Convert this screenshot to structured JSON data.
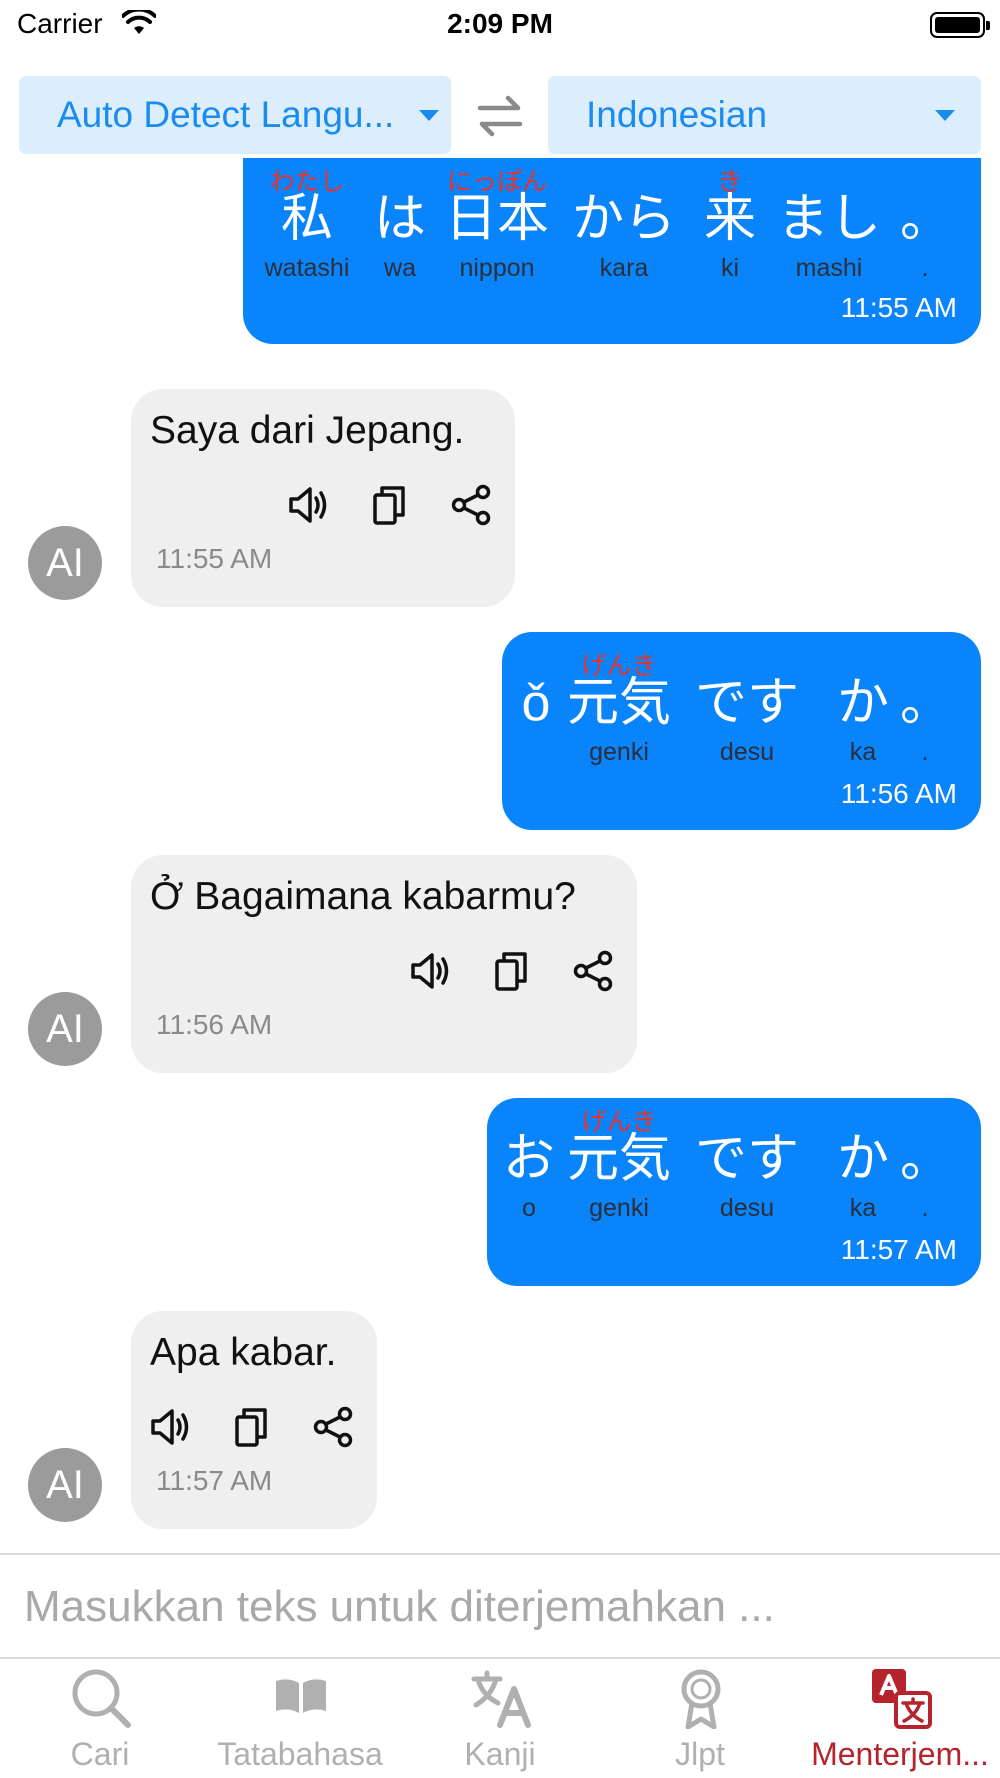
{
  "status_bar": {
    "carrier": "Carrier",
    "time": "2:09 PM"
  },
  "language_bar": {
    "source_language": "Auto Detect Langu...",
    "target_language": "Indonesian"
  },
  "messages": [
    {
      "sender": "user",
      "words": [
        {
          "kana": "私",
          "furigana": "わたし",
          "romaji": "watashi"
        },
        {
          "kana": "は",
          "furigana": "",
          "romaji": "wa"
        },
        {
          "kana": "日本",
          "furigana": "にっぽん",
          "romaji": "nippon"
        },
        {
          "kana": "から",
          "furigana": "",
          "romaji": "kara"
        },
        {
          "kana": "来",
          "furigana": "き",
          "romaji": "ki"
        },
        {
          "kana": "まし",
          "furigana": "",
          "romaji": "mashi"
        },
        {
          "kana": "。",
          "furigana": "",
          "romaji": "."
        }
      ],
      "time": "11:55 AM"
    },
    {
      "sender": "ai",
      "text": "Saya dari Jepang.",
      "time": "11:55 AM",
      "avatar": "AI"
    },
    {
      "sender": "user",
      "words": [
        {
          "kana": "ǒ",
          "furigana": "",
          "romaji": ""
        },
        {
          "kana": "元気",
          "furigana": "げんき",
          "romaji": "genki"
        },
        {
          "kana": "です",
          "furigana": "",
          "romaji": "desu"
        },
        {
          "kana": "か",
          "furigana": "",
          "romaji": "ka"
        },
        {
          "kana": "。",
          "furigana": "",
          "romaji": "."
        }
      ],
      "time": "11:56 AM"
    },
    {
      "sender": "ai",
      "text": "Ở Bagaimana kabarmu?",
      "time": "11:56 AM",
      "avatar": "AI"
    },
    {
      "sender": "user",
      "words": [
        {
          "kana": "お",
          "furigana": "",
          "romaji": "o"
        },
        {
          "kana": "元気",
          "furigana": "げんき",
          "romaji": "genki"
        },
        {
          "kana": "です",
          "furigana": "",
          "romaji": "desu"
        },
        {
          "kana": "か",
          "furigana": "",
          "romaji": "ka"
        },
        {
          "kana": "。",
          "furigana": "",
          "romaji": "."
        }
      ],
      "time": "11:57 AM"
    },
    {
      "sender": "ai",
      "text": "Apa kabar.",
      "time": "11:57 AM",
      "avatar": "AI"
    }
  ],
  "message_actions": [
    "speaker-icon",
    "copy-icon",
    "share-icon"
  ],
  "input": {
    "placeholder": "Masukkan teks untuk diterjemahkan ..."
  },
  "tabs": [
    {
      "label": "Cari",
      "icon": "search-icon",
      "active": false
    },
    {
      "label": "Tatabahasa",
      "icon": "book-icon",
      "active": false
    },
    {
      "label": "Kanji",
      "icon": "translate-kanji-icon",
      "active": false
    },
    {
      "label": "Jlpt",
      "icon": "award-icon",
      "active": false
    },
    {
      "label": "Menterjem...",
      "icon": "translator-icon",
      "active": true
    }
  ],
  "colors": {
    "accent": "#0984fb",
    "furigana": "#e8332b",
    "active_tab": "#b5232d",
    "selector_bg": "#dceefb",
    "ai_bubble": "#efefef"
  }
}
